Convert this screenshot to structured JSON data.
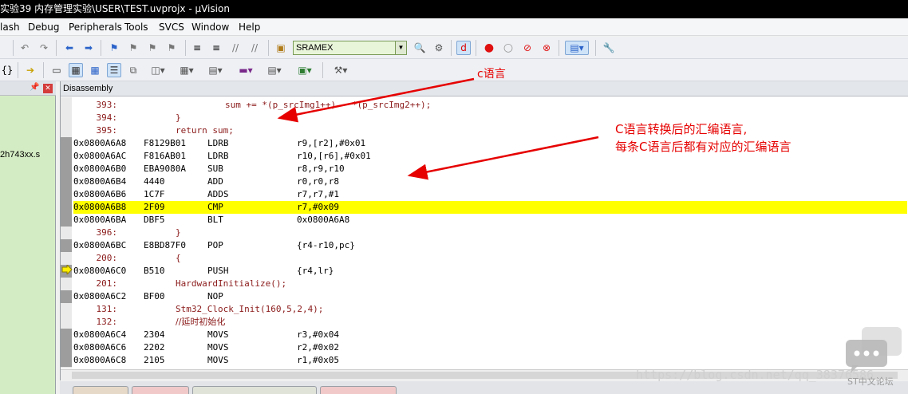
{
  "window": {
    "title": "实验39 内存管理实验\\USER\\TEST.uvprojx - µVision"
  },
  "menu": [
    "lash",
    "Debug",
    "Peripherals",
    "Tools",
    "SVCS",
    "Window",
    "Help"
  ],
  "toolbar": {
    "target_combo_value": "SRAMEX"
  },
  "left_panel": {
    "file_label": "2h743xx.s"
  },
  "disassembly": {
    "title": "Disassembly",
    "lines": [
      {
        "kind": "src",
        "num": "393:",
        "text": "sum += *(p_srcImg1++) - *(p_srcImg2++);"
      },
      {
        "kind": "src",
        "num": "394:",
        "text": "}"
      },
      {
        "kind": "src",
        "num": "395:",
        "text": "return sum;"
      },
      {
        "kind": "asm",
        "addr": "0x0800A6A8",
        "code": "F8129B01",
        "mnem": "LDRB",
        "ops": "r9,[r2],#0x01"
      },
      {
        "kind": "asm",
        "addr": "0x0800A6AC",
        "code": "F816AB01",
        "mnem": "LDRB",
        "ops": "r10,[r6],#0x01"
      },
      {
        "kind": "asm",
        "addr": "0x0800A6B0",
        "code": "EBA9080A",
        "mnem": "SUB",
        "ops": "r8,r9,r10"
      },
      {
        "kind": "asm",
        "addr": "0x0800A6B4",
        "code": "4440",
        "mnem": "ADD",
        "ops": "r0,r0,r8"
      },
      {
        "kind": "asm",
        "addr": "0x0800A6B6",
        "code": "1C7F",
        "mnem": "ADDS",
        "ops": "r7,r7,#1"
      },
      {
        "kind": "asm",
        "addr": "0x0800A6B8",
        "code": "2F09",
        "mnem": "CMP",
        "ops": "r7,#0x09",
        "highlight": true
      },
      {
        "kind": "asm",
        "addr": "0x0800A6BA",
        "code": "DBF5",
        "mnem": "BLT",
        "ops": "0x0800A6A8"
      },
      {
        "kind": "src",
        "num": "396:",
        "text": "}"
      },
      {
        "kind": "asm",
        "addr": "0x0800A6BC",
        "code": "E8BD87F0",
        "mnem": "POP",
        "ops": "{r4-r10,pc}"
      },
      {
        "kind": "src",
        "num": "200:",
        "text": "{"
      },
      {
        "kind": "asm",
        "addr": "0x0800A6C0",
        "code": "B510",
        "mnem": "PUSH",
        "ops": "{r4,lr}"
      },
      {
        "kind": "src",
        "num": "201:",
        "text": "HardwardInitialize();"
      },
      {
        "kind": "asm",
        "addr": "0x0800A6C2",
        "code": "BF00",
        "mnem": "NOP",
        "ops": ""
      },
      {
        "kind": "src",
        "num": "131:",
        "text": "Stm32_Clock_Init(160,5,2,4);"
      },
      {
        "kind": "src",
        "num": "132:",
        "text": "//延时初始化"
      },
      {
        "kind": "asm",
        "addr": "0x0800A6C4",
        "code": "2304",
        "mnem": "MOVS",
        "ops": "r3,#0x04"
      },
      {
        "kind": "asm",
        "addr": "0x0800A6C6",
        "code": "2202",
        "mnem": "MOVS",
        "ops": "r2,#0x02"
      },
      {
        "kind": "asm",
        "addr": "0x0800A6C8",
        "code": "2105",
        "mnem": "MOVS",
        "ops": "r1,#0x05"
      }
    ]
  },
  "annotations": {
    "c_label": "c语言",
    "asm_line1": "C语言转换后的汇编语言,",
    "asm_line2": "每条C语言后都有对应的汇编语言",
    "color": "#e60000"
  },
  "watermark": {
    "url": "https://blog.csdn.net/qq_38376586",
    "forum": "ST中文论坛"
  }
}
